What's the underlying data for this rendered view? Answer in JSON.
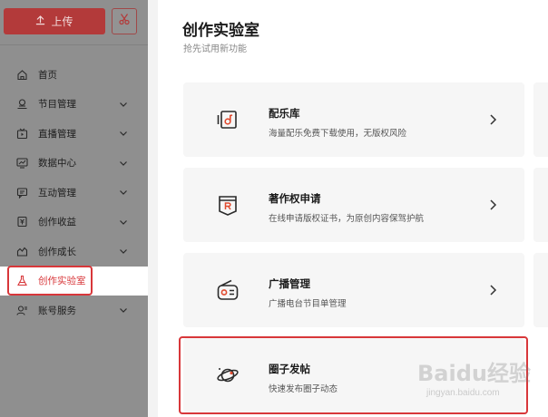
{
  "topbar": {
    "upload_label": "上传"
  },
  "sidebar": {
    "items": [
      {
        "label": "首页",
        "icon": "home-icon",
        "has_chevron": false
      },
      {
        "label": "节目管理",
        "icon": "program-icon",
        "has_chevron": true
      },
      {
        "label": "直播管理",
        "icon": "live-icon",
        "has_chevron": true
      },
      {
        "label": "数据中心",
        "icon": "data-icon",
        "has_chevron": true
      },
      {
        "label": "互动管理",
        "icon": "chat-icon",
        "has_chevron": true
      },
      {
        "label": "创作收益",
        "icon": "income-icon",
        "has_chevron": true
      },
      {
        "label": "创作成长",
        "icon": "growth-icon",
        "has_chevron": true
      },
      {
        "label": "创作实验室",
        "icon": "flask-icon",
        "has_chevron": false,
        "active": true
      },
      {
        "label": "账号服务",
        "icon": "account-icon",
        "has_chevron": true
      }
    ]
  },
  "main": {
    "title": "创作实验室",
    "subtitle": "抢先试用新功能",
    "cards": [
      {
        "title": "配乐库",
        "desc": "海量配乐免费下载使用，无版权风险",
        "icon": "music-library-icon"
      },
      {
        "title": "著作权申请",
        "desc": "在线申请版权证书，为原创内容保驾护航",
        "icon": "copyright-icon"
      },
      {
        "title": "广播管理",
        "desc": "广播电台节目单管理",
        "icon": "radio-icon"
      },
      {
        "title": "圈子发帖",
        "desc": "快速发布圈子动态",
        "icon": "planet-icon"
      }
    ]
  },
  "watermark": {
    "brand": "Baidu经验",
    "url": "jingyan.baidu.com"
  },
  "colors": {
    "accent": "#d8373a",
    "sidebar_dim": "#8f8f8f",
    "card_bg": "#f6f6f6"
  }
}
